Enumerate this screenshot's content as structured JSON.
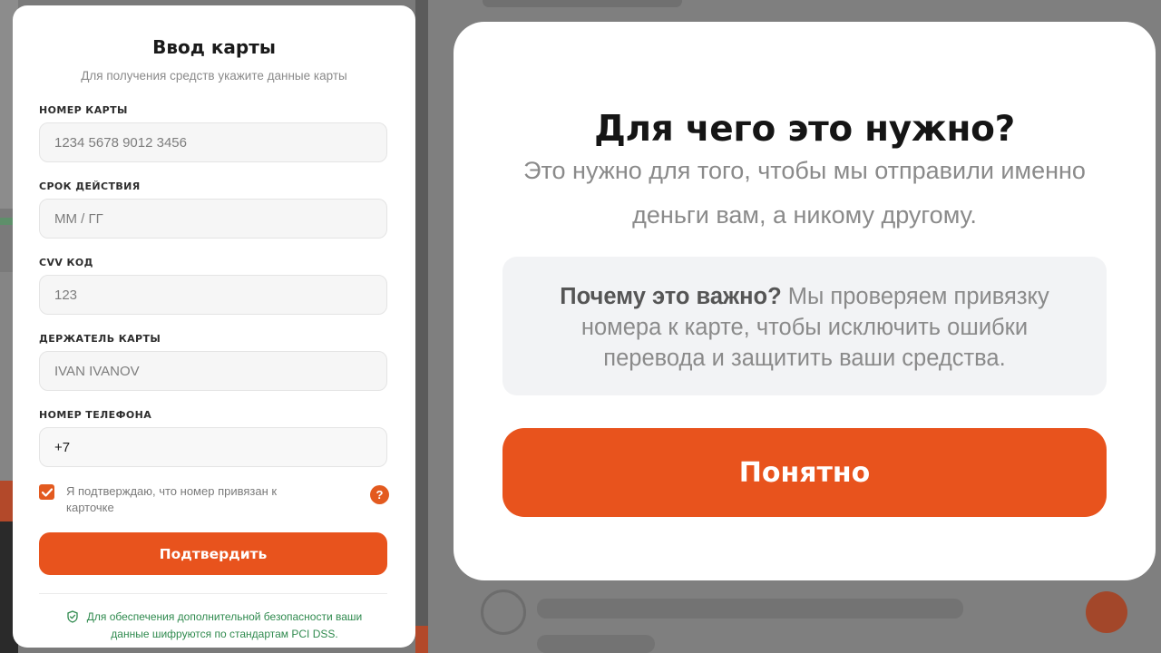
{
  "form": {
    "title": "Ввод карты",
    "subtitle": "Для получения средств укажите данные карты",
    "fields": [
      {
        "label": "НОМЕР КАРТЫ",
        "placeholder": "1234 5678 9012 3456",
        "value": ""
      },
      {
        "label": "СРОК ДЕЙСТВИЯ",
        "placeholder": "ММ / ГГ",
        "value": ""
      },
      {
        "label": "CVV КОД",
        "placeholder": "123",
        "value": ""
      },
      {
        "label": "ДЕРЖАТЕЛЬ КАРТЫ",
        "placeholder": "IVAN IVANOV",
        "value": ""
      },
      {
        "label": "НОМЕР ТЕЛЕФОНА",
        "placeholder": "",
        "value": "+7"
      }
    ],
    "checkbox": {
      "checked": true,
      "label": "Я подтверждаю, что номер привязан к карточке"
    },
    "help_icon": "?",
    "confirm_label": "Подтвердить",
    "security_line1": "Для обеспечения дополнительной безопасности ваши",
    "security_line2": "данные шифруются по стандартам PCI DSS.",
    "accent_color": "#e8531d",
    "security_color": "#2f8a4e"
  },
  "modal": {
    "title": "Для чего это нужно?",
    "text_line1": "Это нужно для того, чтобы мы отправили именно",
    "text_line2": "деньги вам, а никому другому.",
    "info_strong": "Почему это важно?",
    "info_text_1": " Мы проверяем привязку",
    "info_text_2": "номера к карте, чтобы исключить ошибки",
    "info_text_3": "перевода и защитить ваши средства.",
    "button_label": "Понятно"
  }
}
